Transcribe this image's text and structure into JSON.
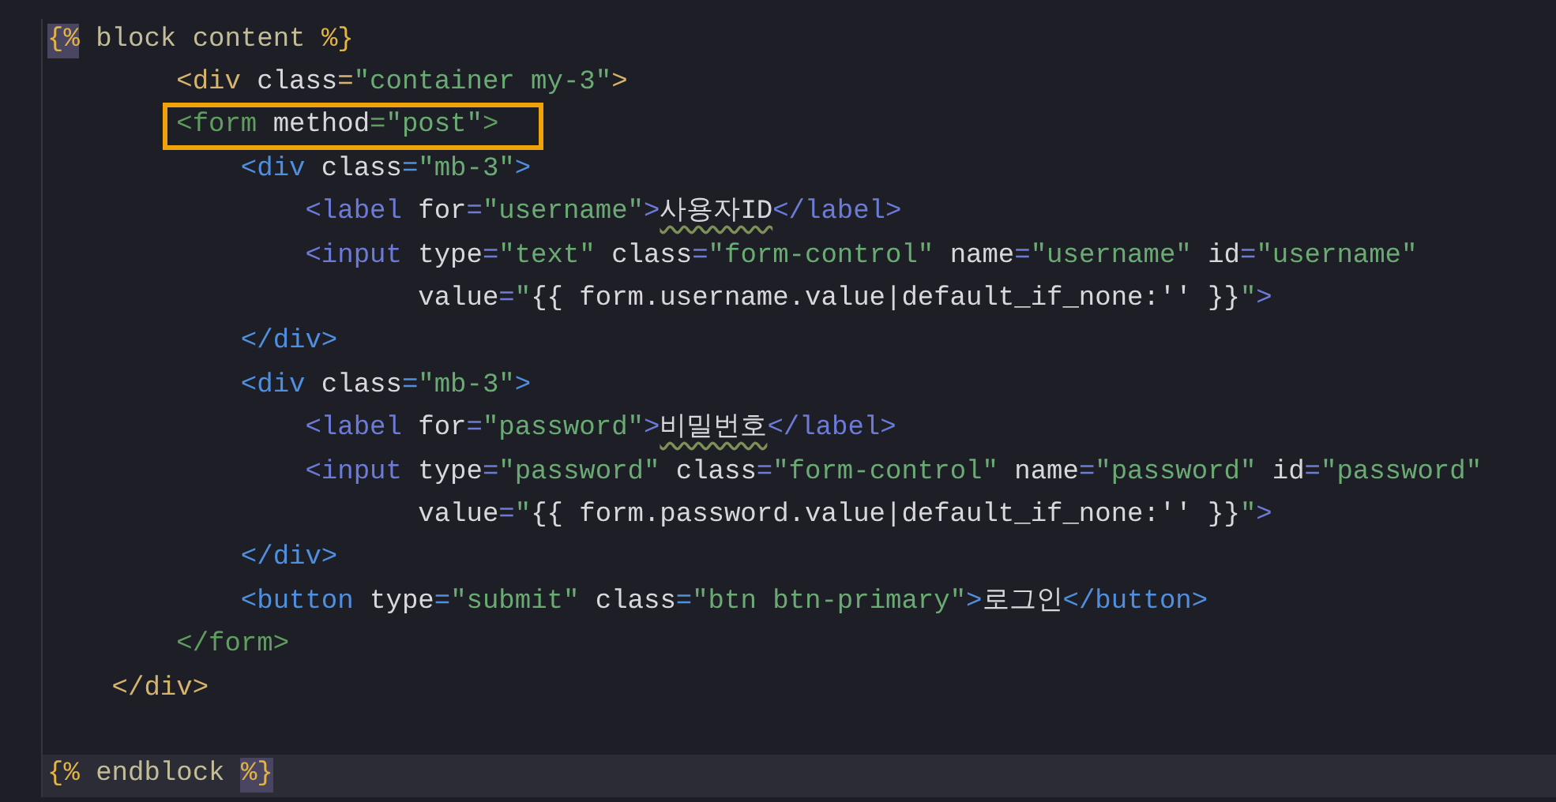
{
  "editor": {
    "lines": [
      {
        "current": false,
        "boxed": false,
        "tokens": [
          {
            "text": "{%",
            "highlighted": true
          },
          {
            "text": " block content ",
            "color": "#c2bd98"
          },
          {
            "text": "%}",
            "color": "#e3b445",
            "highlighted": false
          }
        ]
      },
      {
        "current": false,
        "boxed": false,
        "tokens": [
          {
            "text": "        <div",
            "color": "#d6b46e"
          },
          {
            "text": " class",
            "color": "#d8d8dc"
          },
          {
            "text": "=",
            "color": "#d6b46e"
          },
          {
            "text": "\"container my-3\"",
            "color": "#6aab73"
          },
          {
            "text": ">",
            "color": "#d6b46e"
          }
        ]
      },
      {
        "current": false,
        "boxed": true,
        "tokens": [
          {
            "text": "        <form",
            "color": "#5f9e5f"
          },
          {
            "text": " method",
            "color": "#d8d8dc"
          },
          {
            "text": "=",
            "color": "#5f9e5f"
          },
          {
            "text": "\"post\"",
            "color": "#6aab73"
          },
          {
            "text": ">",
            "color": "#5f9e5f"
          }
        ]
      },
      {
        "current": false,
        "boxed": false,
        "tokens": [
          {
            "text": "            <div",
            "color": "#4f8fe0"
          },
          {
            "text": " class",
            "color": "#d8d8dc"
          },
          {
            "text": "=",
            "color": "#4f8fe0"
          },
          {
            "text": "\"mb-3\"",
            "color": "#6aab73"
          },
          {
            "text": ">",
            "color": "#4f8fe0"
          }
        ]
      },
      {
        "current": false,
        "boxed": false,
        "tokens": [
          {
            "text": "                <label",
            "color": "#6c7bd8"
          },
          {
            "text": " for",
            "color": "#d8d8dc"
          },
          {
            "text": "=",
            "color": "#6c7bd8"
          },
          {
            "text": "\"username\"",
            "color": "#6aab73"
          },
          {
            "text": ">",
            "color": "#6c7bd8"
          },
          {
            "text": "사용자ID",
            "color": "#d8d8dc",
            "squiggle": true
          },
          {
            "text": "</label>",
            "color": "#6c7bd8"
          }
        ]
      },
      {
        "current": false,
        "boxed": false,
        "tokens": [
          {
            "text": "                <input",
            "color": "#6c7bd8"
          },
          {
            "text": " type",
            "color": "#d8d8dc"
          },
          {
            "text": "=",
            "color": "#6c7bd8"
          },
          {
            "text": "\"text\"",
            "color": "#6aab73"
          },
          {
            "text": " class",
            "color": "#d8d8dc"
          },
          {
            "text": "=",
            "color": "#6c7bd8"
          },
          {
            "text": "\"form-control\"",
            "color": "#6aab73"
          },
          {
            "text": " name",
            "color": "#d8d8dc"
          },
          {
            "text": "=",
            "color": "#6c7bd8"
          },
          {
            "text": "\"username\"",
            "color": "#6aab73"
          },
          {
            "text": " id",
            "color": "#d8d8dc"
          },
          {
            "text": "=",
            "color": "#6c7bd8"
          },
          {
            "text": "\"username\"",
            "color": "#6aab73"
          }
        ]
      },
      {
        "current": false,
        "boxed": false,
        "tokens": [
          {
            "text": "                       value",
            "color": "#d8d8dc"
          },
          {
            "text": "=",
            "color": "#6c7bd8"
          },
          {
            "text": "\"",
            "color": "#6aab73"
          },
          {
            "text": "{{ form.username.value|default_if_none:'' }}",
            "color": "#d8d8dc"
          },
          {
            "text": "\"",
            "color": "#6aab73"
          },
          {
            "text": ">",
            "color": "#6c7bd8"
          }
        ]
      },
      {
        "current": false,
        "boxed": false,
        "tokens": [
          {
            "text": "            </div>",
            "color": "#4f8fe0"
          }
        ]
      },
      {
        "current": false,
        "boxed": false,
        "tokens": [
          {
            "text": "            <div",
            "color": "#4f8fe0"
          },
          {
            "text": " class",
            "color": "#d8d8dc"
          },
          {
            "text": "=",
            "color": "#4f8fe0"
          },
          {
            "text": "\"mb-3\"",
            "color": "#6aab73"
          },
          {
            "text": ">",
            "color": "#4f8fe0"
          }
        ]
      },
      {
        "current": false,
        "boxed": false,
        "tokens": [
          {
            "text": "                <label",
            "color": "#6c7bd8"
          },
          {
            "text": " for",
            "color": "#d8d8dc"
          },
          {
            "text": "=",
            "color": "#6c7bd8"
          },
          {
            "text": "\"password\"",
            "color": "#6aab73"
          },
          {
            "text": ">",
            "color": "#6c7bd8"
          },
          {
            "text": "비밀번호",
            "color": "#d8d8dc",
            "squiggle": true
          },
          {
            "text": "</label>",
            "color": "#6c7bd8"
          }
        ]
      },
      {
        "current": false,
        "boxed": false,
        "tokens": [
          {
            "text": "                <input",
            "color": "#6c7bd8"
          },
          {
            "text": " type",
            "color": "#d8d8dc"
          },
          {
            "text": "=",
            "color": "#6c7bd8"
          },
          {
            "text": "\"password\"",
            "color": "#6aab73"
          },
          {
            "text": " class",
            "color": "#d8d8dc"
          },
          {
            "text": "=",
            "color": "#6c7bd8"
          },
          {
            "text": "\"form-control\"",
            "color": "#6aab73"
          },
          {
            "text": " name",
            "color": "#d8d8dc"
          },
          {
            "text": "=",
            "color": "#6c7bd8"
          },
          {
            "text": "\"password\"",
            "color": "#6aab73"
          },
          {
            "text": " id",
            "color": "#d8d8dc"
          },
          {
            "text": "=",
            "color": "#6c7bd8"
          },
          {
            "text": "\"password\"",
            "color": "#6aab73"
          }
        ]
      },
      {
        "current": false,
        "boxed": false,
        "tokens": [
          {
            "text": "                       value",
            "color": "#d8d8dc"
          },
          {
            "text": "=",
            "color": "#6c7bd8"
          },
          {
            "text": "\"",
            "color": "#6aab73"
          },
          {
            "text": "{{ form.password.value|default_if_none:'' }}",
            "color": "#d8d8dc"
          },
          {
            "text": "\"",
            "color": "#6aab73"
          },
          {
            "text": ">",
            "color": "#6c7bd8"
          }
        ]
      },
      {
        "current": false,
        "boxed": false,
        "tokens": [
          {
            "text": "            </div>",
            "color": "#4f8fe0"
          }
        ]
      },
      {
        "current": false,
        "boxed": false,
        "tokens": [
          {
            "text": "            <button",
            "color": "#4f8fe0"
          },
          {
            "text": " type",
            "color": "#d8d8dc"
          },
          {
            "text": "=",
            "color": "#4f8fe0"
          },
          {
            "text": "\"submit\"",
            "color": "#6aab73"
          },
          {
            "text": " class",
            "color": "#d8d8dc"
          },
          {
            "text": "=",
            "color": "#4f8fe0"
          },
          {
            "text": "\"btn btn-primary\"",
            "color": "#6aab73"
          },
          {
            "text": ">",
            "color": "#4f8fe0"
          },
          {
            "text": "로그인",
            "color": "#d8d8dc"
          },
          {
            "text": "</button>",
            "color": "#4f8fe0"
          }
        ]
      },
      {
        "current": false,
        "boxed": false,
        "tokens": [
          {
            "text": "        </form>",
            "color": "#5f9e5f"
          }
        ]
      },
      {
        "current": false,
        "boxed": false,
        "tokens": [
          {
            "text": "    </div>",
            "color": "#d6b46e"
          }
        ]
      },
      {
        "current": false,
        "boxed": false
      },
      {
        "current": true,
        "boxed": false,
        "tokens": [
          {
            "text": "{%",
            "color": "#e3b445",
            "highlighted": false
          },
          {
            "text": " endblock ",
            "color": "#c2bd98"
          },
          {
            "text": "%}",
            "highlighted": true
          }
        ]
      }
    ]
  }
}
